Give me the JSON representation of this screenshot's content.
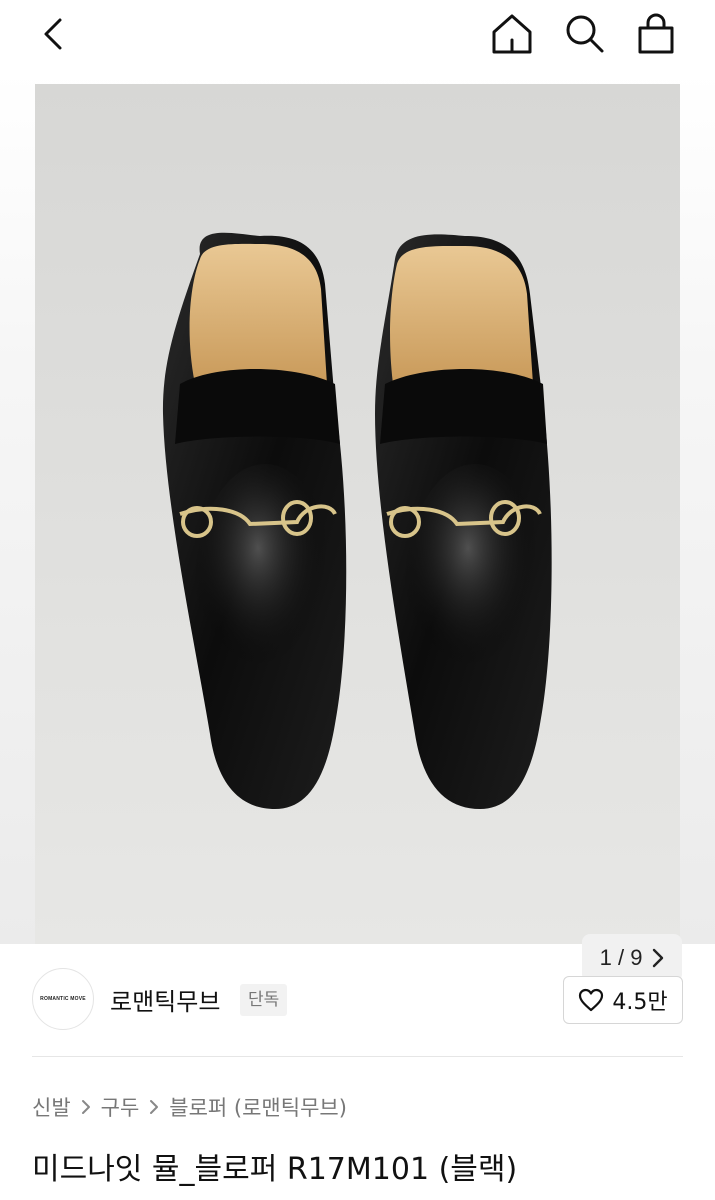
{
  "header": {
    "icons": {
      "back": "chevron-left-icon",
      "home": "home-icon",
      "search": "search-icon",
      "cart": "shopping-bag-icon"
    }
  },
  "gallery": {
    "current": "1",
    "separator": "/",
    "total": "9",
    "next_icon": "chevron-right-icon",
    "image_description": "black leather horsebit mule loafers"
  },
  "shop": {
    "logo_text": "ROMANTIC MOVE",
    "name": "로맨틱무브",
    "badge": "단독",
    "like_icon": "heart-icon",
    "like_count": "4.5만"
  },
  "breadcrumb": {
    "items": [
      "신발",
      "구두",
      "블로퍼 (로맨틱무브)"
    ],
    "separator_icon": "chevron-right-icon"
  },
  "product": {
    "title": "미드나잇 뮬_블로퍼 R17M101 (블랙)"
  },
  "colors": {
    "accent_text": "#111111",
    "muted_text": "#777777",
    "badge_bg": "#f2f2f2"
  }
}
